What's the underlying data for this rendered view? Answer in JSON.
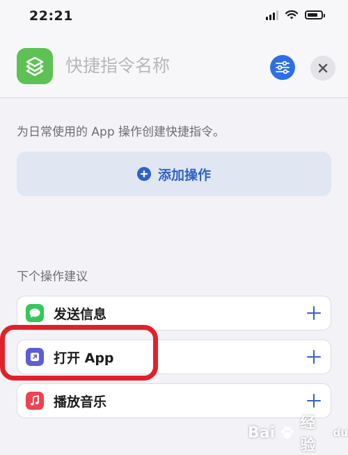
{
  "status_bar": {
    "time": "22:21"
  },
  "header": {
    "title_placeholder": "快捷指令名称",
    "settings_icon": "sliders-icon",
    "close_icon": "close-icon"
  },
  "description": "为日常使用的 App 操作创建快捷指令。",
  "add_action": {
    "label": "添加操作"
  },
  "suggestions": {
    "title": "下个操作建议",
    "items": [
      {
        "label": "发送信息",
        "icon": "message-bubble-icon",
        "color": "#34c759"
      },
      {
        "label": "打开 App",
        "icon": "open-app-arrow-icon",
        "color": "#5b5ed6"
      },
      {
        "label": "播放音乐",
        "icon": "music-note-icon",
        "color": "#f0424f"
      }
    ]
  },
  "watermark": {
    "brand": "Bai",
    "brand_2": "经验",
    "brand_sub": "du"
  },
  "colors": {
    "accent": "#2f62c9",
    "highlight": "#e2202a",
    "shortcut_icon": "#5dc254"
  }
}
